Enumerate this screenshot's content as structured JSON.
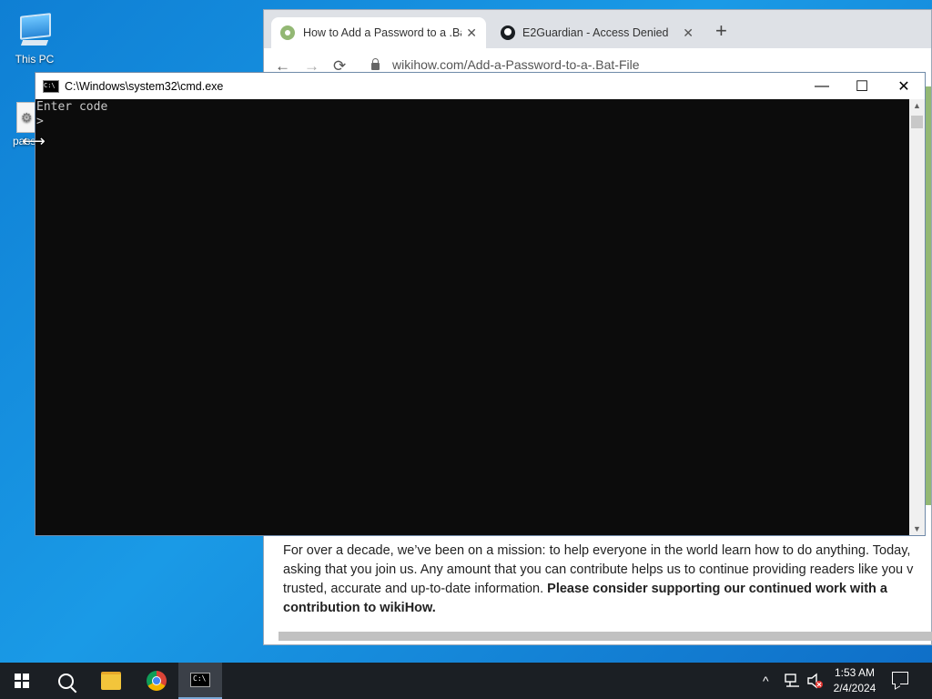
{
  "desktop": {
    "icons": [
      {
        "label": "This PC"
      },
      {
        "label": "pass"
      }
    ]
  },
  "browser": {
    "tabs": [
      {
        "title": "How to Add a Password to a .Bat",
        "close": "✕"
      },
      {
        "title": "E2Guardian - Access Denied",
        "close": "✕"
      }
    ],
    "new_tab": "+",
    "nav": {
      "back": "←",
      "forward": "→",
      "reload": "⟳"
    },
    "url": "wikihow.com/Add-a-Password-to-a-.Bat-File",
    "page": {
      "line1": "For over a decade, we’ve been on a mission: to help everyone in the world learn how to do anything. Today,",
      "line2": "asking that you join us. Any amount that you can contribute helps us to continue providing readers like you v",
      "line3_normal": "trusted, accurate and up-to-date information. ",
      "line3_bold": "Please consider supporting our continued work with a",
      "line4_bold": "contribution to wikiHow."
    }
  },
  "cmd": {
    "title": "C:\\Windows\\system32\\cmd.exe",
    "icon_text": "C:\\",
    "buttons": {
      "minimize": "—",
      "maximize": "☐",
      "close": "✕"
    },
    "output": [
      "Enter code",
      ">"
    ]
  },
  "taskbar": {
    "items": [
      "Start",
      "Search",
      "File Explorer",
      "Google Chrome",
      "Command Prompt"
    ],
    "tray": {
      "chevron": "^",
      "network_icon": "network-icon",
      "volume_icon": "volume-muted-icon"
    },
    "time": "1:53 AM",
    "date": "2/4/2024"
  },
  "colors": {
    "desktop": "#1a8fe0",
    "taskbar": "#1b1f24",
    "console_bg": "#0c0c0c",
    "console_text": "#c8c8c8",
    "wikihow_green": "#93b874"
  }
}
